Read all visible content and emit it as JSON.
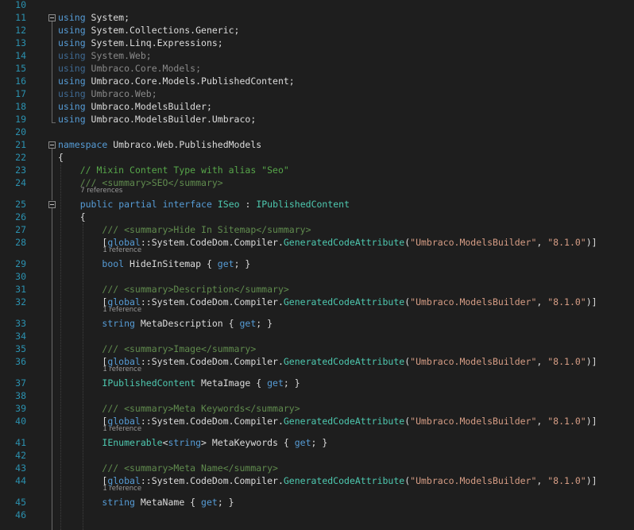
{
  "editor": {
    "lines": [
      {
        "n": "10",
        "tokens": []
      },
      {
        "n": "11",
        "tokens": [
          {
            "t": "using",
            "c": "kw"
          },
          {
            "t": " System;"
          }
        ]
      },
      {
        "n": "12",
        "tokens": [
          {
            "t": "using",
            "c": "kw"
          },
          {
            "t": " System.Collections.Generic;"
          }
        ]
      },
      {
        "n": "13",
        "tokens": [
          {
            "t": "using",
            "c": "kw"
          },
          {
            "t": " System.Linq.Expressions;"
          }
        ]
      },
      {
        "n": "14",
        "tokens": [
          {
            "t": "using",
            "c": "kwd"
          },
          {
            "t": " System.Web;",
            "c": "dim"
          }
        ]
      },
      {
        "n": "15",
        "tokens": [
          {
            "t": "using",
            "c": "kwd"
          },
          {
            "t": " Umbraco.Core.Models;",
            "c": "dim"
          }
        ]
      },
      {
        "n": "16",
        "tokens": [
          {
            "t": "using",
            "c": "kw"
          },
          {
            "t": " Umbraco.Core.Models.PublishedContent;"
          }
        ]
      },
      {
        "n": "17",
        "tokens": [
          {
            "t": "using",
            "c": "kwd"
          },
          {
            "t": " Umbraco.Web;",
            "c": "dim"
          }
        ]
      },
      {
        "n": "18",
        "tokens": [
          {
            "t": "using",
            "c": "kw"
          },
          {
            "t": " Umbraco.ModelsBuilder;"
          }
        ]
      },
      {
        "n": "19",
        "tokens": [
          {
            "t": "using",
            "c": "kw"
          },
          {
            "t": " Umbraco.ModelsBuilder.Umbraco;"
          }
        ]
      },
      {
        "n": "20",
        "tokens": []
      },
      {
        "n": "21",
        "tokens": [
          {
            "t": "namespace",
            "c": "kw"
          },
          {
            "t": " Umbraco.Web.PublishedModels"
          }
        ]
      },
      {
        "n": "22",
        "tokens": [
          {
            "t": "{"
          }
        ]
      },
      {
        "n": "23",
        "tokens": [
          {
            "t": "    "
          },
          {
            "t": "// Mixin Content Type with alias \"Seo\"",
            "c": "cmt"
          }
        ]
      },
      {
        "n": "24",
        "tokens": [
          {
            "t": "    "
          },
          {
            "t": "/// <summary>SEO</summary>",
            "c": "doc"
          }
        ]
      },
      {
        "n": "25",
        "tokens": [
          {
            "t": "    "
          },
          {
            "t": "public",
            "c": "kw"
          },
          {
            "t": " "
          },
          {
            "t": "partial",
            "c": "kw"
          },
          {
            "t": " "
          },
          {
            "t": "interface",
            "c": "kw"
          },
          {
            "t": " "
          },
          {
            "t": "ISeo",
            "c": "typ"
          },
          {
            "t": " : "
          },
          {
            "t": "IPublishedContent",
            "c": "typ"
          }
        ]
      },
      {
        "n": "26",
        "tokens": [
          {
            "t": "    {"
          }
        ]
      },
      {
        "n": "27",
        "tokens": [
          {
            "t": "        "
          },
          {
            "t": "/// <summary>Hide In Sitemap</summary>",
            "c": "doc"
          }
        ]
      },
      {
        "n": "28",
        "tokens": [
          {
            "t": "        ["
          },
          {
            "t": "global",
            "c": "kw"
          },
          {
            "t": "::System.CodeDom.Compiler."
          },
          {
            "t": "GeneratedCodeAttribute",
            "c": "typ"
          },
          {
            "t": "("
          },
          {
            "t": "\"Umbraco.ModelsBuilder\"",
            "c": "str"
          },
          {
            "t": ", "
          },
          {
            "t": "\"8.1.0\"",
            "c": "str"
          },
          {
            "t": ")]"
          }
        ]
      },
      {
        "n": "29",
        "tokens": [
          {
            "t": "        "
          },
          {
            "t": "bool",
            "c": "kw"
          },
          {
            "t": " HideInSitemap { "
          },
          {
            "t": "get",
            "c": "kw"
          },
          {
            "t": "; }"
          }
        ]
      },
      {
        "n": "30",
        "tokens": []
      },
      {
        "n": "31",
        "tokens": [
          {
            "t": "        "
          },
          {
            "t": "/// <summary>Description</summary>",
            "c": "doc"
          }
        ]
      },
      {
        "n": "32",
        "tokens": [
          {
            "t": "        ["
          },
          {
            "t": "global",
            "c": "kw"
          },
          {
            "t": "::System.CodeDom.Compiler."
          },
          {
            "t": "GeneratedCodeAttribute",
            "c": "typ"
          },
          {
            "t": "("
          },
          {
            "t": "\"Umbraco.ModelsBuilder\"",
            "c": "str"
          },
          {
            "t": ", "
          },
          {
            "t": "\"8.1.0\"",
            "c": "str"
          },
          {
            "t": ")]"
          }
        ]
      },
      {
        "n": "33",
        "tokens": [
          {
            "t": "        "
          },
          {
            "t": "string",
            "c": "kw"
          },
          {
            "t": " MetaDescription { "
          },
          {
            "t": "get",
            "c": "kw"
          },
          {
            "t": "; }"
          }
        ]
      },
      {
        "n": "34",
        "tokens": []
      },
      {
        "n": "35",
        "tokens": [
          {
            "t": "        "
          },
          {
            "t": "/// <summary>Image</summary>",
            "c": "doc"
          }
        ]
      },
      {
        "n": "36",
        "tokens": [
          {
            "t": "        ["
          },
          {
            "t": "global",
            "c": "kw"
          },
          {
            "t": "::System.CodeDom.Compiler."
          },
          {
            "t": "GeneratedCodeAttribute",
            "c": "typ"
          },
          {
            "t": "("
          },
          {
            "t": "\"Umbraco.ModelsBuilder\"",
            "c": "str"
          },
          {
            "t": ", "
          },
          {
            "t": "\"8.1.0\"",
            "c": "str"
          },
          {
            "t": ")]"
          }
        ]
      },
      {
        "n": "37",
        "tokens": [
          {
            "t": "        "
          },
          {
            "t": "IPublishedContent",
            "c": "typ"
          },
          {
            "t": " MetaImage { "
          },
          {
            "t": "get",
            "c": "kw"
          },
          {
            "t": "; }"
          }
        ]
      },
      {
        "n": "38",
        "tokens": []
      },
      {
        "n": "39",
        "tokens": [
          {
            "t": "        "
          },
          {
            "t": "/// <summary>Meta Keywords</summary>",
            "c": "doc"
          }
        ]
      },
      {
        "n": "40",
        "tokens": [
          {
            "t": "        ["
          },
          {
            "t": "global",
            "c": "kw"
          },
          {
            "t": "::System.CodeDom.Compiler."
          },
          {
            "t": "GeneratedCodeAttribute",
            "c": "typ"
          },
          {
            "t": "("
          },
          {
            "t": "\"Umbraco.ModelsBuilder\"",
            "c": "str"
          },
          {
            "t": ", "
          },
          {
            "t": "\"8.1.0\"",
            "c": "str"
          },
          {
            "t": ")]"
          }
        ]
      },
      {
        "n": "41",
        "tokens": [
          {
            "t": "        "
          },
          {
            "t": "IEnumerable",
            "c": "typ"
          },
          {
            "t": "<"
          },
          {
            "t": "string",
            "c": "kw"
          },
          {
            "t": "> MetaKeywords { "
          },
          {
            "t": "get",
            "c": "kw"
          },
          {
            "t": "; }"
          }
        ]
      },
      {
        "n": "42",
        "tokens": []
      },
      {
        "n": "43",
        "tokens": [
          {
            "t": "        "
          },
          {
            "t": "/// <summary>Meta Name</summary>",
            "c": "doc"
          }
        ]
      },
      {
        "n": "44",
        "tokens": [
          {
            "t": "        ["
          },
          {
            "t": "global",
            "c": "kw"
          },
          {
            "t": "::System.CodeDom.Compiler."
          },
          {
            "t": "GeneratedCodeAttribute",
            "c": "typ"
          },
          {
            "t": "("
          },
          {
            "t": "\"Umbraco.ModelsBuilder\"",
            "c": "str"
          },
          {
            "t": ", "
          },
          {
            "t": "\"8.1.0\"",
            "c": "str"
          },
          {
            "t": ")]"
          }
        ]
      },
      {
        "n": "45",
        "tokens": [
          {
            "t": "        "
          },
          {
            "t": "string",
            "c": "kw"
          },
          {
            "t": " MetaName { "
          },
          {
            "t": "get",
            "c": "kw"
          },
          {
            "t": "; }"
          }
        ]
      },
      {
        "n": "46",
        "tokens": []
      }
    ],
    "codelens": [
      {
        "after": "24",
        "text": "7 references",
        "indent": 1
      },
      {
        "after": "28",
        "text": "1 reference",
        "indent": 2
      },
      {
        "after": "32",
        "text": "1 reference",
        "indent": 2
      },
      {
        "after": "36",
        "text": "1 reference",
        "indent": 2
      },
      {
        "after": "40",
        "text": "1 reference",
        "indent": 2
      },
      {
        "after": "44",
        "text": "1 reference",
        "indent": 2
      }
    ],
    "folds": [
      "11",
      "21",
      "25"
    ],
    "colors": {
      "background": "#1e1e1e",
      "line_number": "#2b91af",
      "keyword": "#569cd6",
      "type": "#4ec9b0",
      "string": "#d69d85",
      "comment": "#57a64a",
      "codelens": "#999999"
    }
  }
}
